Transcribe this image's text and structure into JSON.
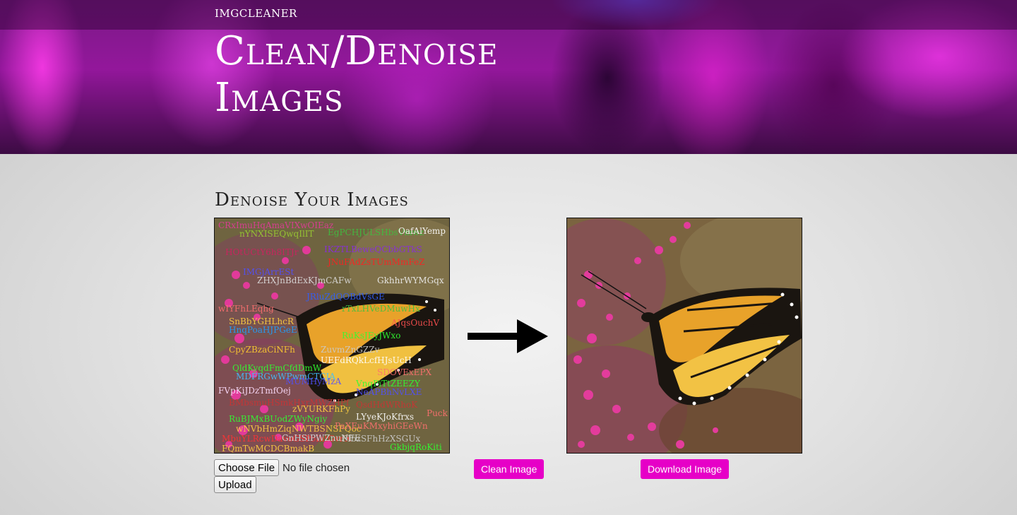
{
  "brand": "IMGCLEANER",
  "hero": {
    "title": "Clean/Denoise Images"
  },
  "section": {
    "heading": "Denoise Your Images"
  },
  "upload": {
    "choose_file_label": "Choose File",
    "no_file_text": "No file chosen",
    "upload_label": "Upload"
  },
  "actions": {
    "clean_label": "Clean Image",
    "download_label": "Download Image"
  },
  "colors": {
    "accent": "#e600c7",
    "hero_base": "#93179b"
  },
  "icons": {
    "arrow": "arrow-right-icon"
  }
}
